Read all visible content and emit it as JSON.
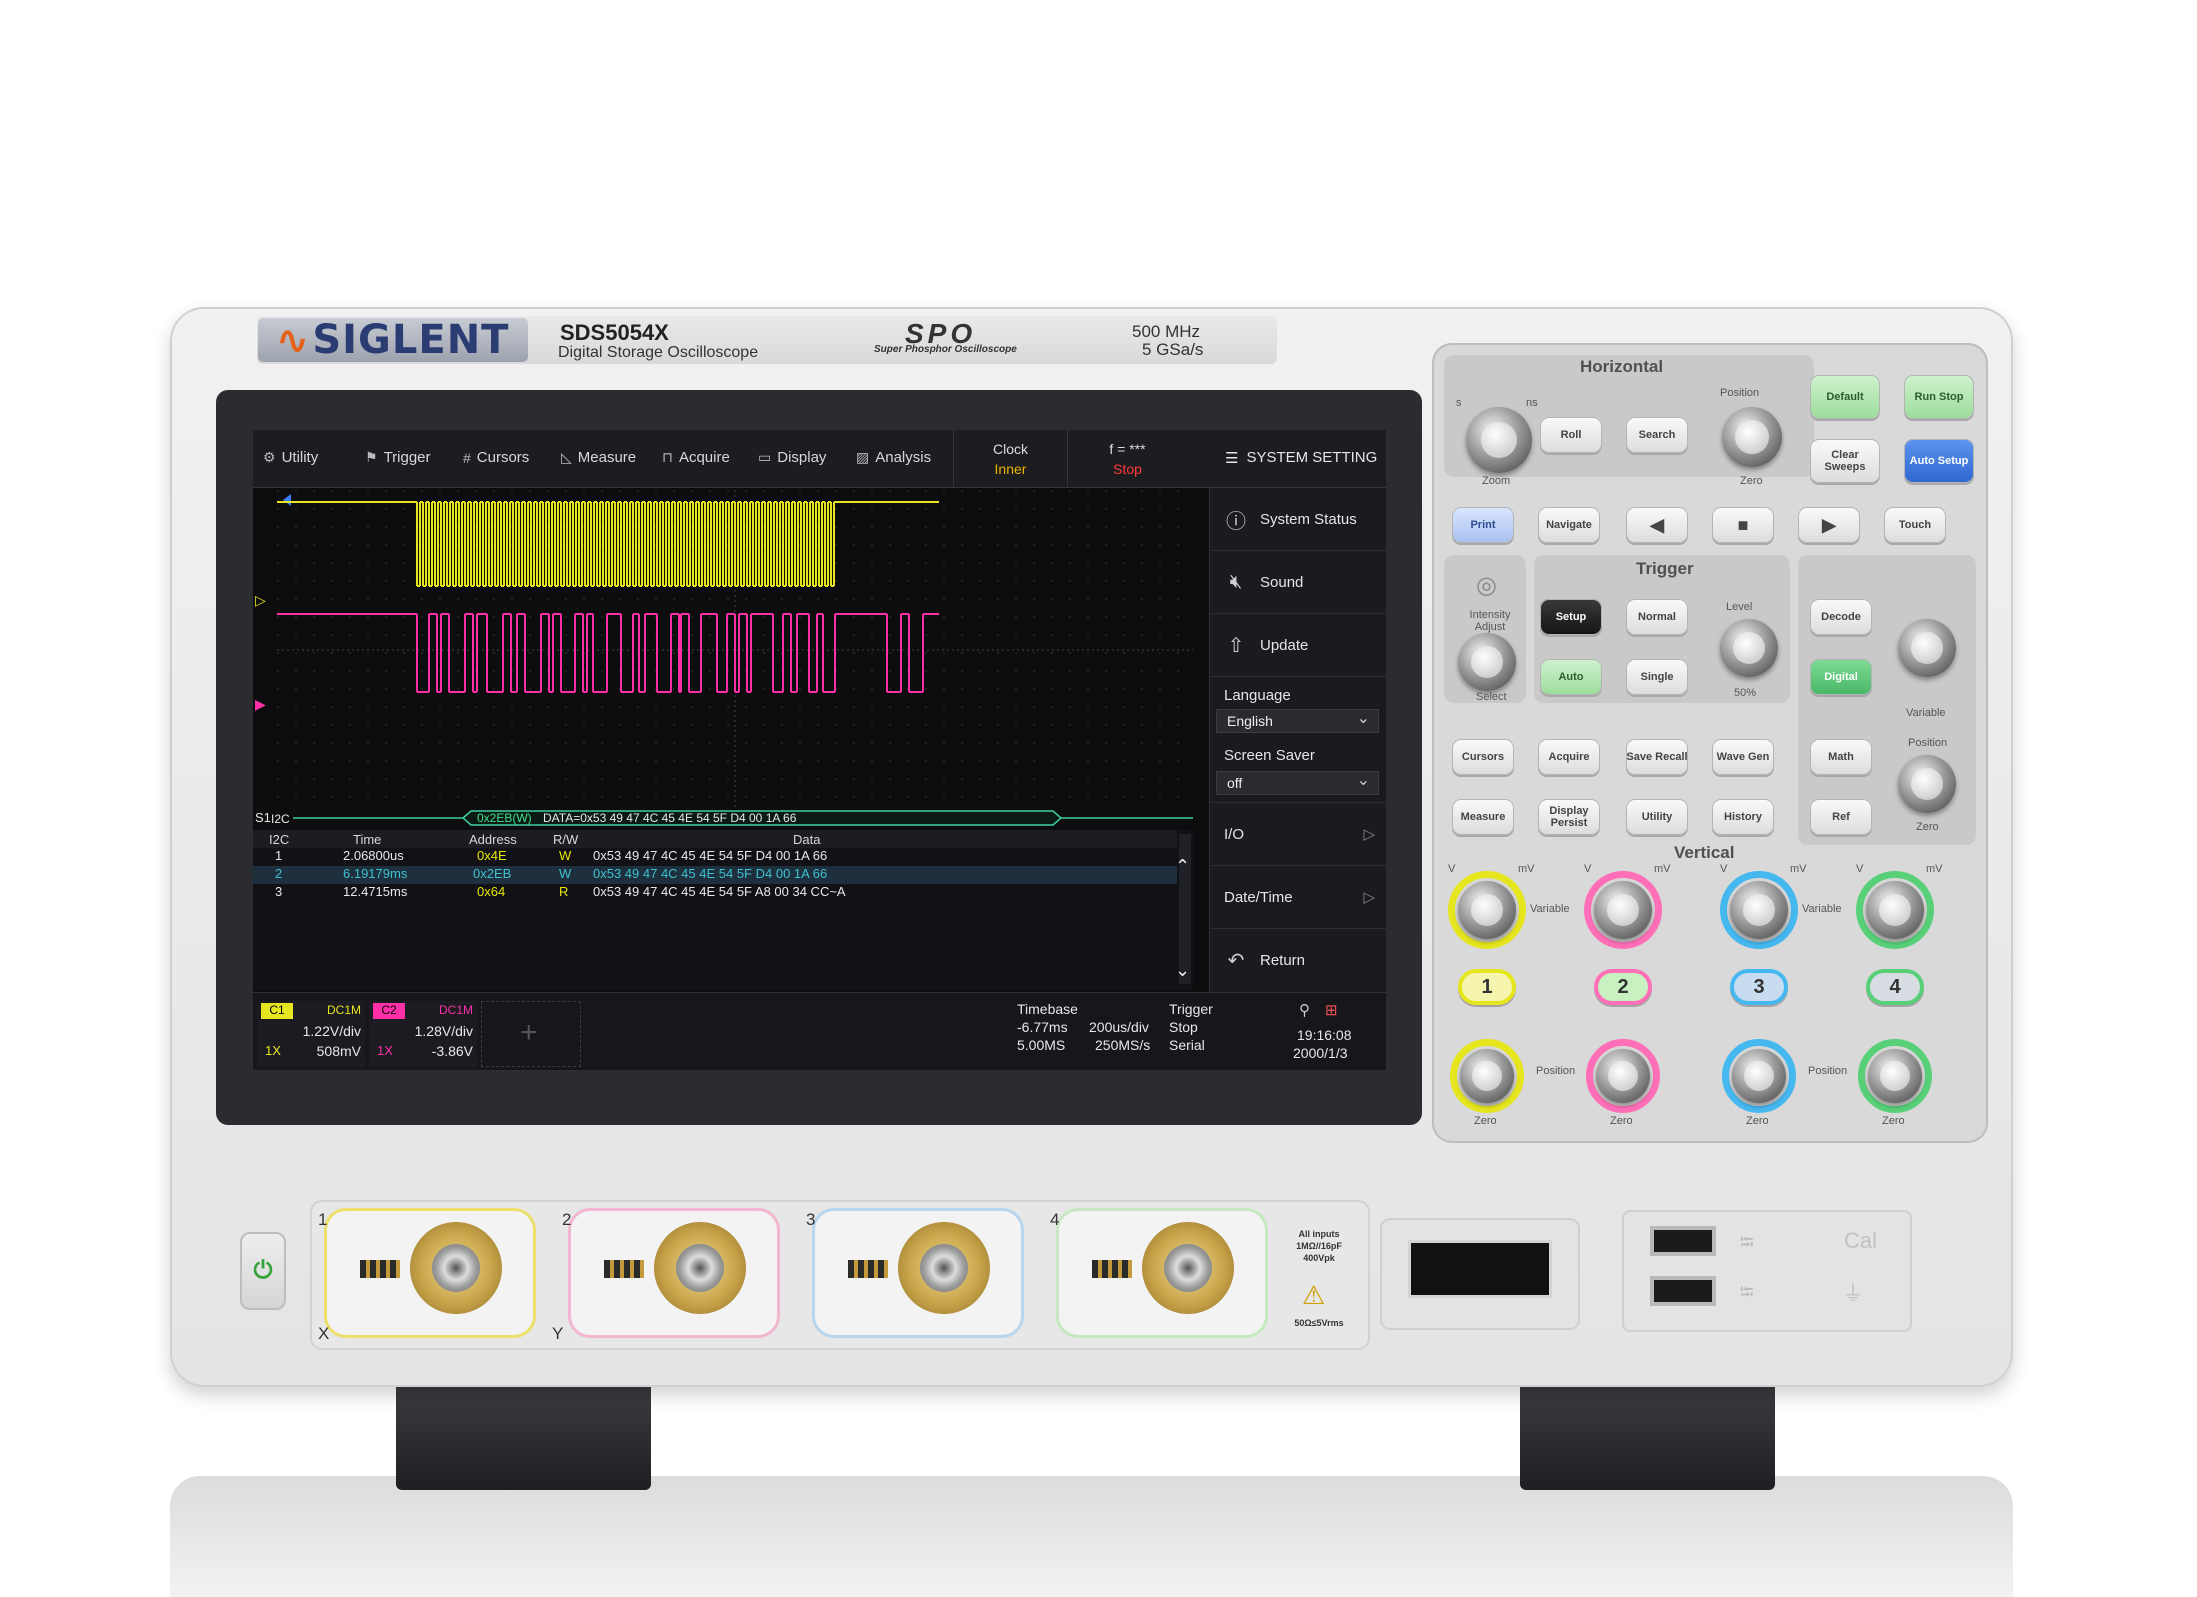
{
  "branding": {
    "logo": "SIGLENT",
    "model": "SDS5054X",
    "description": "Digital Storage Oscilloscope",
    "spo": "SPO",
    "spo_sub": "Super Phosphor Oscilloscope",
    "bandwidth": "500 MHz",
    "sample_rate": "5 GSa/s"
  },
  "menu": {
    "items": [
      {
        "label": "Utility",
        "icon": "gear-icon"
      },
      {
        "label": "Trigger",
        "icon": "flag-icon"
      },
      {
        "label": "Cursors",
        "icon": "hash-icon"
      },
      {
        "label": "Measure",
        "icon": "ruler-icon"
      },
      {
        "label": "Acquire",
        "icon": "acquire-icon"
      },
      {
        "label": "Display",
        "icon": "monitor-icon"
      },
      {
        "label": "Analysis",
        "icon": "chart-icon"
      }
    ],
    "clock_label": "Clock",
    "clock_value": "Inner",
    "freq_label": "f = ***",
    "run_state": "Stop"
  },
  "side_menu": {
    "title": "SYSTEM SETTING",
    "system_status": "System Status",
    "sound": "Sound",
    "update": "Update",
    "language_label": "Language",
    "language_value": "English",
    "screen_saver_label": "Screen Saver",
    "screen_saver_value": "off",
    "io": "I/O",
    "date_time": "Date/Time",
    "return": "Return"
  },
  "waveform": {
    "bus_label": "S1",
    "protocol": "I2C",
    "decode_annotation": "0x2EB(W)",
    "decode_data": "DATA=0x53 49 47 4C 45 4E 54 5F D4 00 1A 66",
    "ch1_color": "#e6e61e",
    "ch2_color": "#ff2fa8"
  },
  "decode_table": {
    "headers": [
      "I2C",
      "Time",
      "Address",
      "R/W",
      "Data"
    ],
    "rows": [
      {
        "idx": "1",
        "time": "2.06800us",
        "address": "0x4E",
        "rw": "W",
        "data": "0x53 49 47 4C 45 4E 54 5F D4 00 1A 66"
      },
      {
        "idx": "2",
        "time": "6.19179ms",
        "address": "0x2EB",
        "rw": "W",
        "data": "0x53 49 47 4C 45 4E 54 5F D4 00 1A 66"
      },
      {
        "idx": "3",
        "time": "12.4715ms",
        "address": "0x64",
        "rw": "R",
        "data": "0x53 49 47 4C 45 4E 54 5F A8 00 34 CC~A"
      }
    ]
  },
  "status": {
    "ch1": {
      "tag": "C1",
      "coupling": "DC1M",
      "vdiv": "1.22V/div",
      "probe": "1X",
      "offset": "508mV"
    },
    "ch2": {
      "tag": "C2",
      "coupling": "DC1M",
      "vdiv": "1.28V/div",
      "probe": "1X",
      "offset": "-3.86V"
    },
    "timebase_label": "Timebase",
    "timebase_delay": "-6.77ms",
    "timebase_scale": "200us/div",
    "memory_depth": "5.00MS",
    "sample_rate": "250MS/s",
    "trigger_label": "Trigger",
    "trigger_state": "Stop",
    "trigger_type": "Serial",
    "time": "19:16:08",
    "date": "2000/1/3"
  },
  "panel": {
    "horizontal": "Horizontal",
    "trigger": "Trigger",
    "vertical": "Vertical",
    "buttons": {
      "default": "Default",
      "run_stop": "Run Stop",
      "roll": "Roll",
      "search": "Search",
      "clear_sweeps": "Clear Sweeps",
      "auto_setup": "Auto Setup",
      "print": "Print",
      "navigate": "Navigate",
      "touch": "Touch",
      "setup": "Setup",
      "normal": "Normal",
      "auto": "Auto",
      "single": "Single",
      "decode": "Decode",
      "digital": "Digital",
      "cursors": "Cursors",
      "acquire": "Acquire",
      "save_recall": "Save Recall",
      "wave_gen": "Wave Gen",
      "math": "Math",
      "measure": "Measure",
      "display_persist": "Display Persist",
      "utility": "Utility",
      "history": "History",
      "ref": "Ref"
    },
    "labels": {
      "zoom": "Zoom",
      "zero": "Zero",
      "position": "Position",
      "intensity_adjust": "Intensity Adjust",
      "select": "Select",
      "level": "Level",
      "fifty": "50%",
      "variable": "Variable",
      "s": "s",
      "ns": "ns",
      "v": "V",
      "mv": "mV"
    },
    "channels": [
      "1",
      "2",
      "3",
      "4"
    ]
  },
  "front": {
    "bnc_labels": [
      "1",
      "2",
      "3",
      "4"
    ],
    "x_label": "X",
    "y_label": "Y",
    "input_note": "All inputs 1MΩ//16pF 400Vpk",
    "vrms": "50Ω≤5Vrms",
    "cal": "Cal",
    "gnd": "⏚"
  }
}
